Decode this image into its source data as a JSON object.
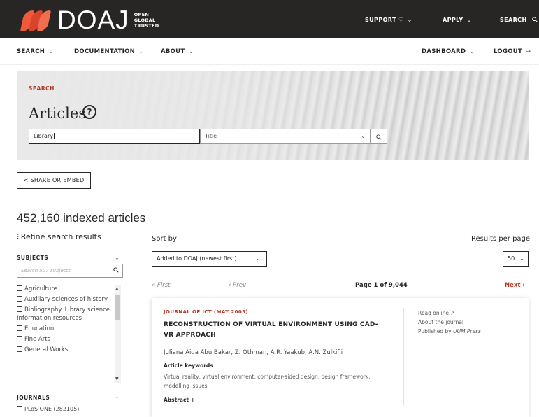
{
  "header": {
    "logo_text": "DOAJ",
    "logo_tagline": [
      "OPEN",
      "GLOBAL",
      "TRUSTED"
    ],
    "nav": [
      {
        "label": "SUPPORT ♡",
        "icon": "chevron-down-icon"
      },
      {
        "label": "APPLY",
        "icon": "chevron-down-icon"
      },
      {
        "label": "SEARCH",
        "icon": "search-icon"
      }
    ]
  },
  "subnav": {
    "left": [
      "SEARCH",
      "DOCUMENTATION",
      "ABOUT"
    ],
    "dashboard": "DASHBOARD",
    "logout": "LOGOUT"
  },
  "hero": {
    "kicker": "SEARCH",
    "title": "Articles",
    "query": "Library",
    "field": "Title"
  },
  "share_label": "SHARE OR EMBED",
  "results": {
    "count_text": "452,160 indexed articles",
    "refine_label": "Refine search results",
    "sort_label": "Sort by",
    "sort_value": "Added to DOAJ (newest first)",
    "per_page_label": "Results per page",
    "per_page_value": "50",
    "pager": {
      "first": "« First",
      "prev": "‹ Prev",
      "page": "Page 1 of 9,044",
      "next": "Next ›"
    }
  },
  "facets": {
    "subjects_label": "SUBJECTS",
    "subjects_search_placeholder": "Search 507 subjects",
    "subjects": [
      "Agriculture",
      "Auxiliary sciences of history",
      "Bibliography. Library science. Information resources",
      "Education",
      "Fine Arts",
      "General Works"
    ],
    "journals_label": "JOURNALS",
    "journals": [
      "PLoS ONE (282105)"
    ]
  },
  "article": {
    "journal": "JOURNAL OF ICT (MAY 2003)",
    "title": "RECONSTRUCTION OF VIRTUAL ENVIRONMENT USING CAD-VR APPROACH",
    "authors": "Juliana Aida Abu Bakar, Z. Othman, A.R. Yaakub, A.N. Zulkifli",
    "keywords_label": "Article keywords",
    "keywords": "Virtual reality, virtual environment, computer-aided design, design framework, modelling issues",
    "abstract_label": "Abstract +",
    "read_online": "Read online",
    "about_journal": "About the journal",
    "published_by_prefix": "Published by",
    "publisher": "UUM Press"
  },
  "colors": {
    "accent": "#b33a27",
    "dark": "#282624",
    "brand": "#f05a3a"
  }
}
